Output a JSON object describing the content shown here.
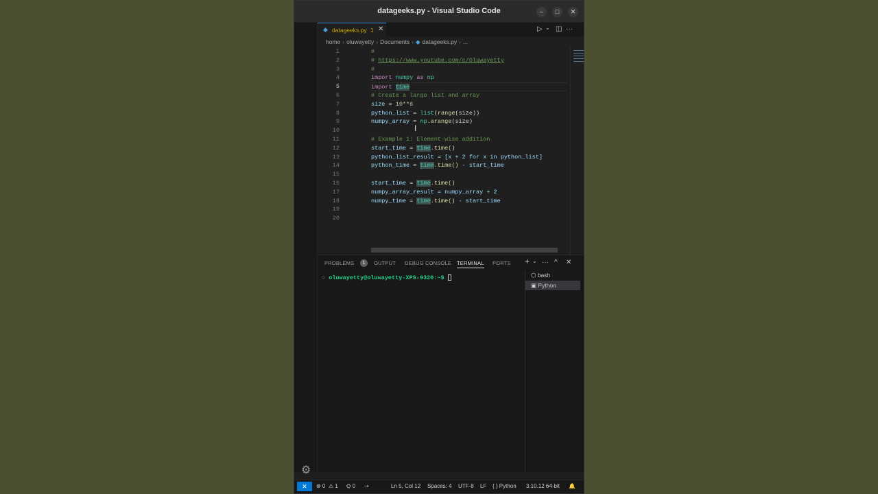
{
  "window": {
    "title": "datageeks.py - Visual Studio Code",
    "minimize": "–",
    "maximize": "□",
    "close": "✕"
  },
  "tab": {
    "icon": "◆",
    "label": "datageeks.py",
    "problems": "1",
    "close": "✕"
  },
  "editor_actions": {
    "run": "▷",
    "run_dropdown": "⌄",
    "split": "◫",
    "more": "···"
  },
  "breadcrumb": {
    "items": [
      "home",
      "oluwayetty",
      "Documents"
    ],
    "file": "datageeks.py",
    "ellipsis": "...",
    "separator": "›"
  },
  "line_numbers": [
    "1",
    "2",
    "3",
    "4",
    "5",
    "6",
    "7",
    "8",
    "9",
    "10",
    "11",
    "12",
    "13",
    "14",
    "15",
    "16",
    "17",
    "18",
    "19",
    "20"
  ],
  "code": {
    "l1": "#",
    "l2_hash": "# ",
    "l2_url": "https://www.youtube.com/c/Oluwayetty",
    "l3": "#",
    "l4_kw": "import",
    "l4_mod": "numpy",
    "l4_as": "as",
    "l4_alias": "np",
    "l5_kw": "import",
    "l5_mod": "time",
    "l6": "# Create a large list and array",
    "l7_var": "size",
    "l7_eq": " = ",
    "l7_num": "10**6",
    "l8_var": "python_list",
    "l8_eq": " = ",
    "l8_fn": "list",
    "l8_p1": "(",
    "l8_fn2": "range",
    "l8_rest": "(size))",
    "l9_var": "numpy_array",
    "l9_eq": " = ",
    "l9_mod": "np",
    "l9_dot": ".",
    "l9_fn": "arange",
    "l9_rest": "(size)",
    "l11": "# Example 1: Element-wise addition",
    "l12_var": "start_time",
    "l12_eq": " = ",
    "l12_mod": "time",
    "l12_fn": ".time()",
    "l13": "python_list_result = [x + 2 for x in python_list]",
    "l14_var": "python_time",
    "l14_eq": " = ",
    "l14_mod": "time",
    "l14_fn": ".time()",
    "l14_rest": " - start_time",
    "l16_var": "start_time",
    "l16_eq": " = ",
    "l16_mod": "time",
    "l16_fn": ".time()",
    "l17": "numpy_array_result = numpy_array + 2",
    "l18_var": "numpy_time",
    "l18_eq": " = ",
    "l18_mod": "time",
    "l18_fn": ".time()",
    "l18_rest": " - start_time"
  },
  "panel": {
    "tabs": [
      "PROBLEMS",
      "OUTPUT",
      "DEBUG CONSOLE",
      "TERMINAL",
      "PORTS"
    ],
    "problems_count": "1",
    "actions": {
      "add": "+",
      "dropdown": "⌄",
      "more": "···",
      "maximize": "^",
      "close": "✕"
    },
    "terminal_dot": "○",
    "prompt": "oluwayetty@oluwayetty-XPS-9320:~$",
    "terminals": [
      {
        "icon": "⬡",
        "label": "bash"
      },
      {
        "icon": "▣",
        "label": "Python"
      }
    ]
  },
  "statusbar": {
    "remote": "✕",
    "errors": "⊗ 0",
    "warnings": "⚠ 1",
    "ports": "⛭ 0",
    "debug": "⇢",
    "position": "Ln 5, Col 12",
    "spaces": "Spaces: 4",
    "encoding": "UTF-8",
    "eol": "LF",
    "language": "{ } Python",
    "interpreter": "3.10.12 64-bit",
    "bell": "🔔"
  },
  "gear_icon": "⚙"
}
